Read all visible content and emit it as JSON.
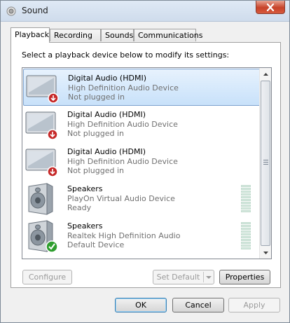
{
  "window": {
    "title": "Sound"
  },
  "tabs": [
    {
      "label": "Playback",
      "active": true
    },
    {
      "label": "Recording",
      "active": false
    },
    {
      "label": "Sounds",
      "active": false
    },
    {
      "label": "Communications",
      "active": false
    }
  ],
  "playback": {
    "instruction": "Select a playback device below to modify its settings:",
    "devices": [
      {
        "name": "Digital Audio (HDMI)",
        "description": "High Definition Audio Device",
        "status": "Not plugged in",
        "icon": "monitor-icon",
        "badge": "unplugged-badge-icon",
        "selected": true
      },
      {
        "name": "Digital Audio (HDMI)",
        "description": "High Definition Audio Device",
        "status": "Not plugged in",
        "icon": "monitor-icon",
        "badge": "unplugged-badge-icon",
        "selected": false
      },
      {
        "name": "Digital Audio (HDMI)",
        "description": "High Definition Audio Device",
        "status": "Not plugged in",
        "icon": "monitor-icon",
        "badge": "unplugged-badge-icon",
        "selected": false
      },
      {
        "name": "Speakers",
        "description": "PlayOn Virtual Audio Device",
        "status": "Ready",
        "icon": "speaker-icon",
        "badge": "",
        "selected": false
      },
      {
        "name": "Speakers",
        "description": "Realtek High Definition Audio",
        "status": "Default Device",
        "icon": "speaker-icon",
        "badge": "default-check-icon",
        "selected": false
      }
    ],
    "buttons": {
      "configure": {
        "label": "Configure",
        "enabled": false
      },
      "set_default": {
        "label": "Set Default",
        "enabled": false
      },
      "properties": {
        "label": "Properties",
        "enabled": true
      }
    }
  },
  "footer": {
    "ok": "OK",
    "cancel": "Cancel",
    "apply": "Apply"
  },
  "colors": {
    "selection": "#c8e1fa",
    "selection_border": "#7da2ce",
    "unplugged": "#c62828",
    "default_check": "#2e9e2e",
    "close_button": "#c7432a"
  }
}
